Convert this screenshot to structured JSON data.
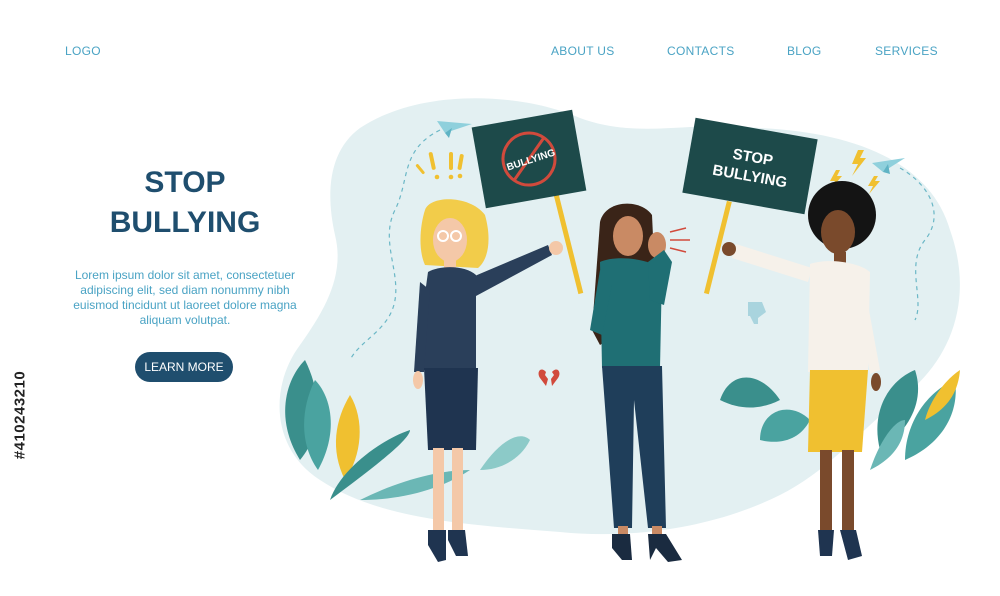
{
  "header": {
    "logo": "LOGO",
    "nav": [
      "ABOUT US",
      "CONTACTS",
      "BLOG",
      "SERVICES"
    ]
  },
  "hero": {
    "title_line1": "STOP",
    "title_line2": "BULLYING",
    "text": "Lorem ipsum dolor sit amet, consectetuer adipiscing elit, sed diam nonummy nibh euismod tincidunt ut laoreet dolore magna aliquam volutpat.",
    "button": "LEARN MORE"
  },
  "illustration": {
    "sign_left": "BULLYING",
    "sign_right_line1": "STOP",
    "sign_right_line2": "BULLYING",
    "exclaim": "!!"
  },
  "watermark": {
    "id": "#410243210"
  },
  "colors": {
    "brand_dark": "#1f4e6e",
    "link_blue": "#4aa3c4",
    "blob": "#e3f0f2",
    "leaf_teal": "#3a8f8c",
    "leaf_yellow": "#f0c030",
    "sign_dark": "#1d4a4a"
  }
}
